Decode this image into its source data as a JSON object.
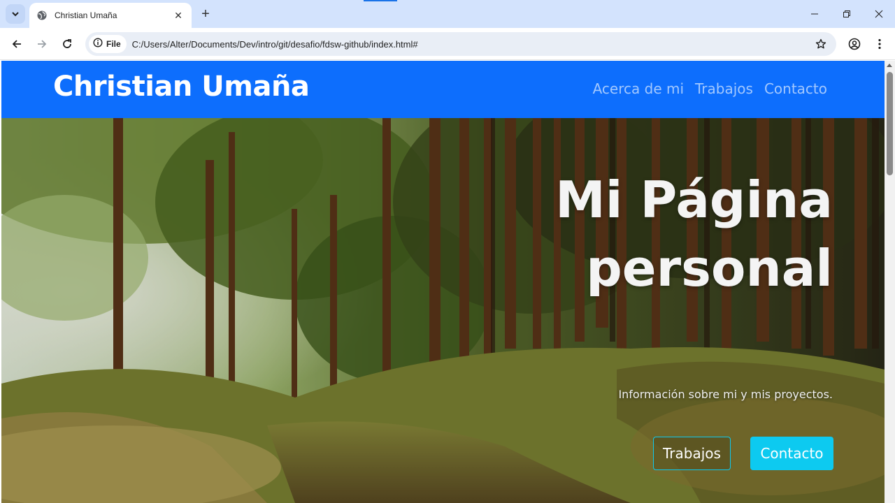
{
  "browser": {
    "tab_title": "Christian Umaña",
    "tab_close": "✕",
    "new_tab": "+",
    "url_chip": "File",
    "url": "C:/Users/Alter/Documents/Dev/intro/git/desafio/fdsw-github/index.html#",
    "icons": [
      "tab-search-icon",
      "globe-icon",
      "close-icon",
      "plus-icon",
      "minimize-icon",
      "restore-icon",
      "close-window-icon",
      "back-arrow-icon",
      "forward-arrow-icon",
      "reload-icon",
      "info-icon",
      "star-icon",
      "profile-icon",
      "kebab-menu-icon"
    ]
  },
  "site": {
    "brand": "Christian Umaña",
    "nav": [
      "Acerca de mi",
      "Trabajos",
      "Contacto"
    ],
    "header_color": "#0d6efd"
  },
  "hero": {
    "title_line1": "Mi Página",
    "title_line2": "personal",
    "subtitle": "Información sobre mi y mis proyectos.",
    "button_outline": "Trabajos",
    "button_solid": "Contacto",
    "accent_color": "#0dcaf0",
    "background": "forest path photo"
  }
}
